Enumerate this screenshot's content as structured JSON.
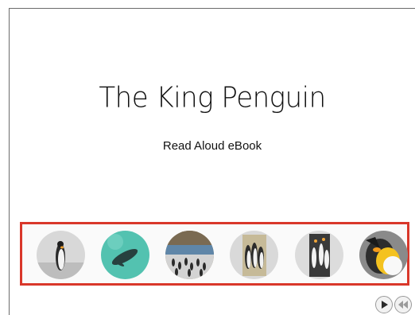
{
  "book": {
    "title": "The King Penguin",
    "subtitle": "Read Aloud eBook"
  },
  "thumbnails": [
    {
      "name": "standing-penguin-thumbnail"
    },
    {
      "name": "swimming-penguin-thumbnail"
    },
    {
      "name": "penguin-colony-beach-thumbnail"
    },
    {
      "name": "three-penguins-thumbnail"
    },
    {
      "name": "penguin-group-thumbnail"
    },
    {
      "name": "penguin-closeup-thumbnail"
    }
  ],
  "controls": {
    "play": "play-icon",
    "back": "rewind-icon"
  },
  "colors": {
    "highlight_border": "#d9372a"
  }
}
